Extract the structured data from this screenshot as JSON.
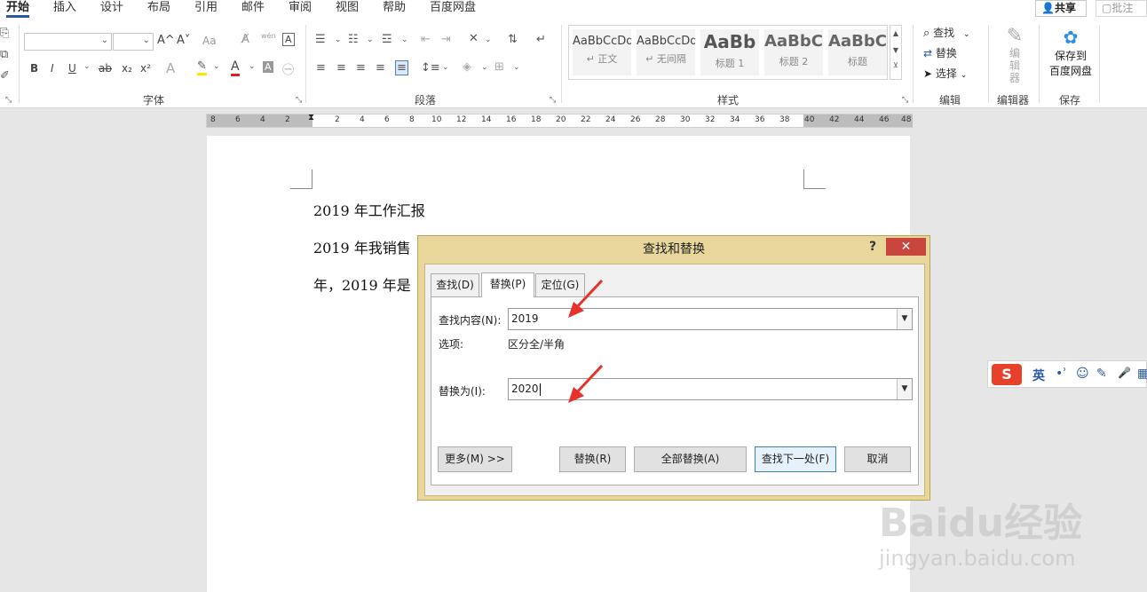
{
  "tabs": [
    {
      "label": "开始",
      "active": true
    },
    {
      "label": "插入"
    },
    {
      "label": "设计"
    },
    {
      "label": "布局"
    },
    {
      "label": "引用"
    },
    {
      "label": "邮件"
    },
    {
      "label": "审阅"
    },
    {
      "label": "视图"
    },
    {
      "label": "帮助"
    },
    {
      "label": "百度网盘"
    }
  ],
  "top_right": {
    "share": "共享",
    "comment": "批注"
  },
  "ribbon": {
    "font_group": "字体",
    "paragraph_group": "段落",
    "styles_group": "样式",
    "edit_group": "编辑",
    "editor_group": "编辑器",
    "save_group": "保存",
    "font_buttons": {
      "bold": "B",
      "italic": "I",
      "underline": "U",
      "strike": "ab",
      "sub": "x₂",
      "sup": "x²",
      "grow": "A^",
      "shrink": "A˅",
      "case": "Aa",
      "wen": "wén",
      "box": "A",
      "color": "A"
    },
    "styles": [
      {
        "sample": "AaBbCcDd",
        "name": "↵ 正文"
      },
      {
        "sample": "AaBbCcDd",
        "name": "↵ 无间隔"
      },
      {
        "sample": "AaBb",
        "name": "标题 1"
      },
      {
        "sample": "AaBbC",
        "name": "标题 2"
      },
      {
        "sample": "AaBbC",
        "name": "标题"
      }
    ],
    "find": "查找",
    "replace": "替换",
    "select": "选择",
    "editor": "编辑器",
    "save_to_line1": "保存到",
    "save_to_line2": "百度网盘"
  },
  "ruler": {
    "left_ticks": [
      "8",
      "6",
      "4",
      "2"
    ],
    "main_ticks": [
      "2",
      "4",
      "6",
      "8",
      "10",
      "12",
      "14",
      "16",
      "18",
      "20",
      "22",
      "24",
      "26",
      "28",
      "30",
      "32",
      "34",
      "36",
      "38"
    ],
    "right_ticks": [
      "40",
      "42",
      "44",
      "46",
      "48"
    ]
  },
  "document": {
    "lines": [
      "2019 年工作汇报",
      "2019 年我销售",
      "年，2019 年是"
    ]
  },
  "dialog": {
    "title": "查找和替换",
    "help": "?",
    "close": "✕",
    "tabs": {
      "find": "查找(D)",
      "replace": "替换(P)",
      "goto": "定位(G)"
    },
    "find_label": "查找内容(N):",
    "find_value": "2019",
    "options_label": "选项:",
    "options_value": "区分全/半角",
    "replace_label": "替换为(I):",
    "replace_value": "2020",
    "buttons": {
      "more": "更多(M) >>",
      "replace": "替换(R)",
      "replace_all": "全部替换(A)",
      "find_next": "查找下一处(F)",
      "cancel": "取消"
    }
  },
  "ime": {
    "logo": "S",
    "lang": "英",
    "punct": "•ʾ",
    "emoji": "☺",
    "tool": "✎",
    "mic": "🎤"
  },
  "watermark": {
    "logo": "Baidu经验",
    "url": "jingyan.baidu.com"
  },
  "colors": {
    "accent": "#2b579a",
    "dialog_frame": "#e8d69a",
    "close": "#c9463d",
    "arrow": "#e8312a"
  }
}
